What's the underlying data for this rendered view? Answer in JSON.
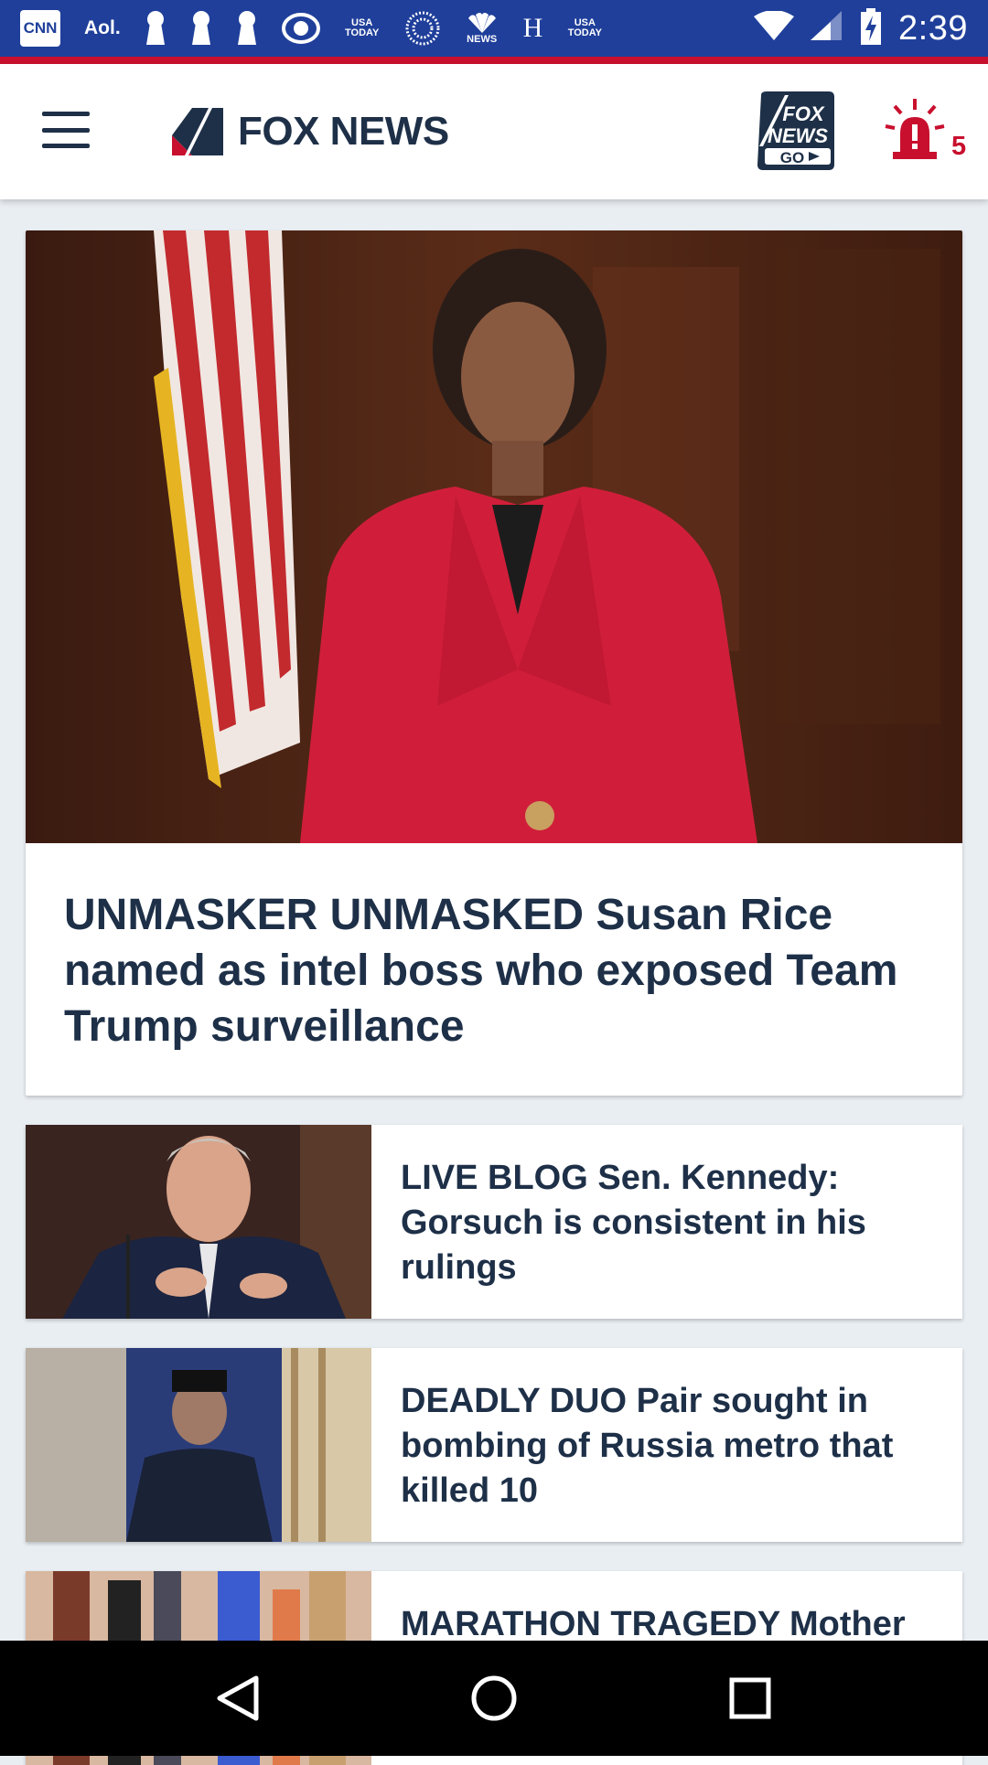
{
  "status_bar": {
    "notification_icons": [
      "cnn-icon",
      "aol-icon",
      "keyhole-icon",
      "keyhole-icon",
      "keyhole-icon",
      "cbs-eye-icon",
      "usa-today-icon",
      "ring-dots-icon",
      "nbc-news-icon",
      "history-h-icon",
      "usa-today-icon"
    ],
    "cnn_label": "CNN",
    "aol_label": "Aol.",
    "usa_today_label": "USA TODAY",
    "news_label": "NEWS",
    "h_label": "H",
    "time": "2:39",
    "colors": {
      "background": "#1f3f9a",
      "accent_line": "#c8102e"
    }
  },
  "header": {
    "brand": "FOX NEWS",
    "go_logo_text": [
      "FOX",
      "NEWS",
      "GO"
    ],
    "alert_count": "5",
    "icons": [
      "menu-icon",
      "fox-news-go-icon",
      "breaking-alert-icon"
    ]
  },
  "feed": {
    "hero": {
      "title": "UNMASKER UNMASKED Susan Rice named as intel boss who exposed Team Trump surveillance"
    },
    "stories": [
      {
        "title": "LIVE BLOG Sen. Kennedy: Gorsuch is consistent in his rulings"
      },
      {
        "title": "DEADLY DUO Pair sought in bombing of Russia metro that killed 10"
      },
      {
        "title": "MARATHON TRAGEDY Mother"
      }
    ]
  },
  "nav": {
    "icons": [
      "back-icon",
      "home-icon",
      "recents-icon"
    ]
  }
}
